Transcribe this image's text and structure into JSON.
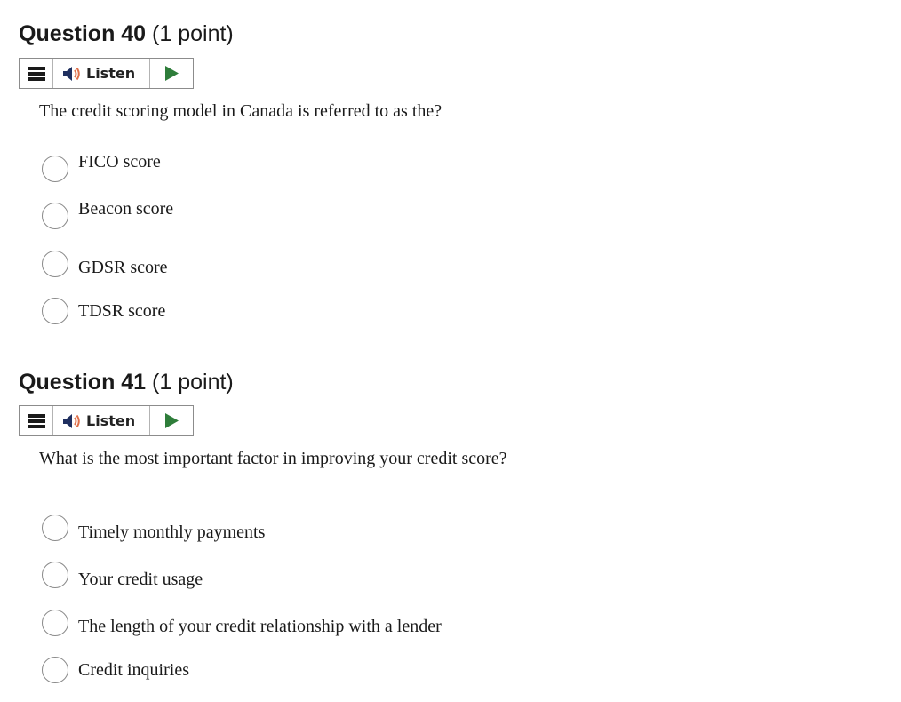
{
  "questions": [
    {
      "number_label": "Question 40",
      "points_label": "(1 point)",
      "listen_label": "Listen",
      "text": "The credit scoring model in Canada is referred to as the?",
      "options": [
        "FICO score",
        "Beacon score",
        "GDSR score",
        "TDSR score"
      ]
    },
    {
      "number_label": "Question 41",
      "points_label": "(1 point)",
      "listen_label": "Listen",
      "text": "What is the most important factor in improving your credit score?",
      "options": [
        "Timely monthly payments",
        "Your credit usage",
        "The length of your credit relationship with a lender",
        "Credit inquiries"
      ]
    }
  ],
  "icons": {
    "menu": "hamburger-icon",
    "speaker": "speaker-icon",
    "play": "play-icon"
  },
  "colors": {
    "play": "#2e7d3a",
    "speaker_waves": "#e0714b"
  }
}
